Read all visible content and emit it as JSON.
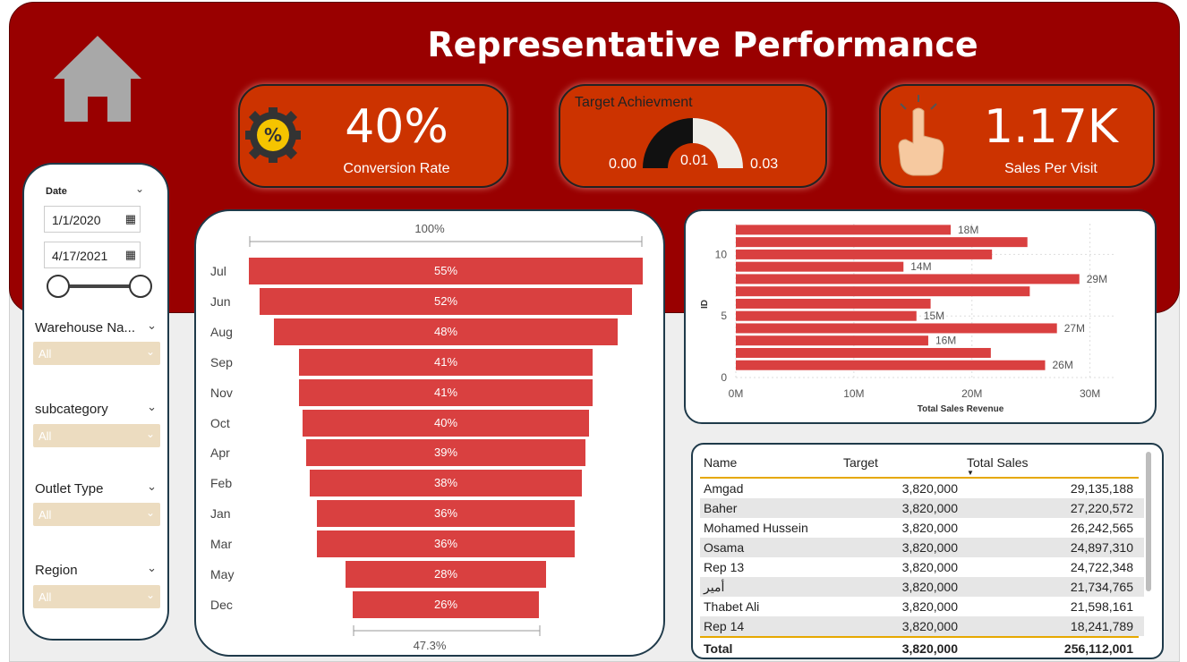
{
  "title": "Representative Performance",
  "kpis": {
    "conversion": {
      "value": "40%",
      "label": "Conversion Rate"
    },
    "target": {
      "label": "Target Achievment",
      "min": "0.00",
      "value": "0.01",
      "max": "0.03"
    },
    "sales_per_visit": {
      "value": "1.17K",
      "label": "Sales Per Visit"
    }
  },
  "filters": {
    "date": {
      "label": "Date",
      "start": "1/1/2020",
      "end": "4/17/2021"
    },
    "slicers": [
      {
        "label": "Warehouse Na...",
        "value": "All"
      },
      {
        "label": "subcategory",
        "value": "All"
      },
      {
        "label": "Outlet Type",
        "value": "All"
      },
      {
        "label": "Region",
        "value": "All"
      }
    ]
  },
  "funnel": {
    "top_label": "100%",
    "bottom_label": "47.3%",
    "rows": [
      {
        "month": "Jul",
        "pct": "55%",
        "value": 55
      },
      {
        "month": "Jun",
        "pct": "52%",
        "value": 52
      },
      {
        "month": "Aug",
        "pct": "48%",
        "value": 48
      },
      {
        "month": "Sep",
        "pct": "41%",
        "value": 41
      },
      {
        "month": "Nov",
        "pct": "41%",
        "value": 41
      },
      {
        "month": "Oct",
        "pct": "40%",
        "value": 40
      },
      {
        "month": "Apr",
        "pct": "39%",
        "value": 39
      },
      {
        "month": "Feb",
        "pct": "38%",
        "value": 38
      },
      {
        "month": "Jan",
        "pct": "36%",
        "value": 36
      },
      {
        "month": "Mar",
        "pct": "36%",
        "value": 36
      },
      {
        "month": "May",
        "pct": "28%",
        "value": 28
      },
      {
        "month": "Dec",
        "pct": "26%",
        "value": 26
      }
    ]
  },
  "chart_data": {
    "type": "bar",
    "orientation": "horizontal",
    "xlabel": "Total Sales Revenue",
    "ylabel": "ID",
    "xlim": [
      0,
      32
    ],
    "x_ticks": [
      "0M",
      "10M",
      "20M",
      "30M"
    ],
    "y_ticks": [
      "0",
      "5",
      "10"
    ],
    "ylim": [
      0,
      12.5
    ],
    "bars": [
      {
        "id": 12,
        "value": 18.2,
        "label": "18M"
      },
      {
        "id": 11,
        "value": 24.7,
        "label": ""
      },
      {
        "id": 10,
        "value": 21.7,
        "label": ""
      },
      {
        "id": 9,
        "value": 14.2,
        "label": "14M"
      },
      {
        "id": 8,
        "value": 29.1,
        "label": "29M"
      },
      {
        "id": 7,
        "value": 24.9,
        "label": ""
      },
      {
        "id": 6,
        "value": 16.5,
        "label": ""
      },
      {
        "id": 5,
        "value": 15.3,
        "label": "15M"
      },
      {
        "id": 4,
        "value": 27.2,
        "label": "27M"
      },
      {
        "id": 3,
        "value": 16.3,
        "label": "16M"
      },
      {
        "id": 2,
        "value": 21.6,
        "label": ""
      },
      {
        "id": 1,
        "value": 26.2,
        "label": "26M"
      }
    ],
    "bar_color": "#d94040"
  },
  "table": {
    "headers": [
      "Name",
      "Target",
      "Total Sales"
    ],
    "rows": [
      [
        "Amgad",
        "3,820,000",
        "29,135,188"
      ],
      [
        "Baher",
        "3,820,000",
        "27,220,572"
      ],
      [
        "Mohamed Hussein",
        "3,820,000",
        "26,242,565"
      ],
      [
        "Osama",
        "3,820,000",
        "24,897,310"
      ],
      [
        "Rep 13",
        "3,820,000",
        "24,722,348"
      ],
      [
        "أمير",
        "3,820,000",
        "21,734,765"
      ],
      [
        "Thabet Ali",
        "3,820,000",
        "21,598,161"
      ],
      [
        "Rep 14",
        "3,820,000",
        "18,241,789"
      ]
    ],
    "total": [
      "Total",
      "3,820,000",
      "256,112,001"
    ]
  },
  "icons": {
    "home": "home-icon",
    "percent": "percent-gear-icon",
    "hand": "pointing-hand-icon",
    "calendar": "calendar-icon"
  },
  "colors": {
    "header": "#990000",
    "kpi": "#cc3300",
    "bar": "#d94040",
    "slicer": "#ecdcc0"
  }
}
